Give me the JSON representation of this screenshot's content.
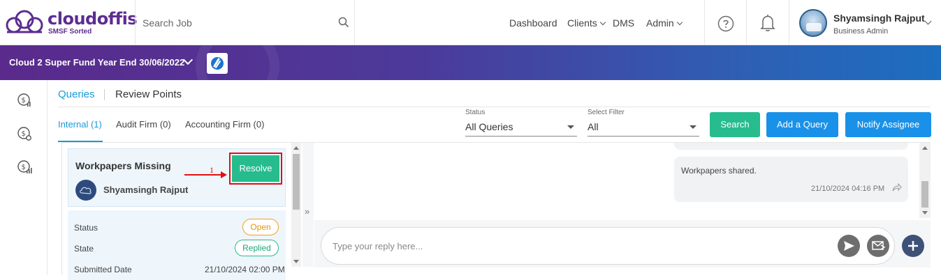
{
  "brand": {
    "name": "cloudoffis",
    "tagline": "SMSF Sorted",
    "color": "#5c2d91"
  },
  "search": {
    "placeholder": "Search Job"
  },
  "nav": {
    "dashboard": "Dashboard",
    "clients": "Clients",
    "dms": "DMS",
    "admin": "Admin"
  },
  "user": {
    "name": "Shyamsingh Rajput",
    "role": "Business Admin"
  },
  "banner": {
    "title": "Cloud 2 Super Fund Year End 30/06/2022"
  },
  "tabs": {
    "queries": "Queries",
    "review_points": "Review Points"
  },
  "subtabs": {
    "internal": "Internal (1)",
    "audit_firm": "Audit Firm (0)",
    "accounting_firm": "Accounting Firm (0)"
  },
  "filters": {
    "status_label": "Status",
    "status_value": "All Queries",
    "select_label": "Select Filter",
    "select_value": "All"
  },
  "buttons": {
    "search": "Search",
    "add_query": "Add a Query",
    "notify": "Notify Assignee"
  },
  "query_card": {
    "title": "Workpapers Missing",
    "resolve": "Resolve",
    "user": "Shyamsingh Rajput",
    "annotation": "1"
  },
  "details": {
    "status_label": "Status",
    "status_value": "Open",
    "state_label": "State",
    "state_value": "Replied",
    "cut_label": "Submitted Date",
    "cut_value": "21/10/2024 02:00 PM"
  },
  "chat": {
    "message": "Workpapers shared.",
    "time": "21/10/2024 04:16 PM"
  },
  "reply": {
    "placeholder": "Type your reply here..."
  },
  "colors": {
    "accent_blue": "#1a91e8",
    "accent_green": "#27bc8d",
    "annotation_red": "#e01010"
  }
}
